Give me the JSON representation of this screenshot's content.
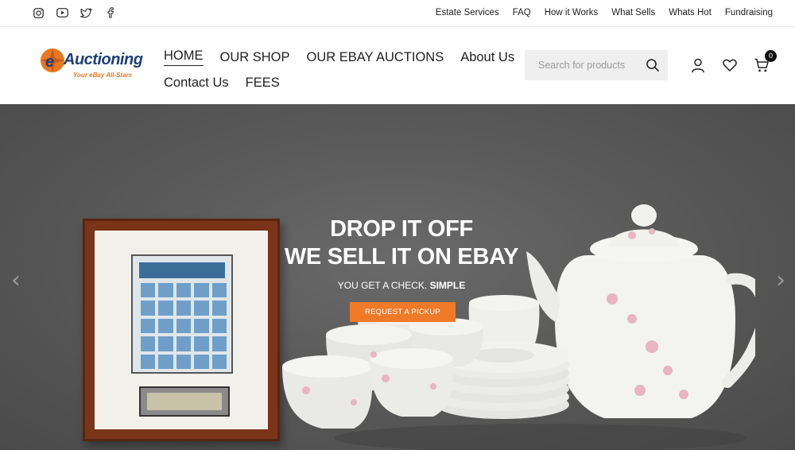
{
  "topbar": {
    "social_icons": [
      "instagram-icon",
      "youtube-icon",
      "twitter-icon",
      "facebook-icon"
    ],
    "links": [
      "Estate Services",
      "FAQ",
      "How it Works",
      "What Sells",
      "Whats Hot",
      "Fundraising"
    ]
  },
  "header": {
    "logo": {
      "wordmark": "Auctioning",
      "tagline": "Your eBay All-Stars"
    },
    "nav": {
      "row1": [
        "HOME",
        "OUR SHOP",
        "OUR EBAY AUCTIONS",
        "About Us"
      ],
      "row2": [
        "Contact Us",
        "FEES"
      ]
    },
    "search": {
      "placeholder": "Search for products"
    },
    "cart_count": "0"
  },
  "hero": {
    "headline_line1": "DROP IT OFF",
    "headline_line2": "WE SELL IT ON EBAY",
    "subtext": "YOU GET A CHECK.",
    "subtext_bold": "SIMPLE",
    "cta_label": "REQUEST A PICKUP",
    "prev_arrow": "‹",
    "next_arrow": "›"
  },
  "colors": {
    "accent": "#ef7a28",
    "brand_blue": "#1f3f7a",
    "hero_bg": "#5a5a5a"
  }
}
